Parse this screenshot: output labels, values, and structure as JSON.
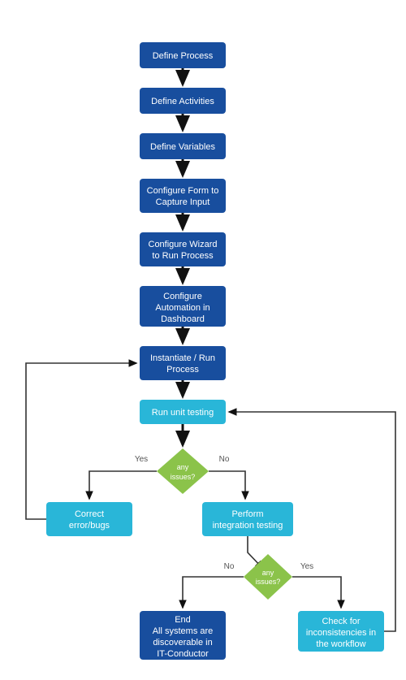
{
  "colors": {
    "dark_blue": "#184e9e",
    "light_blue": "#29b6d8",
    "green": "#8bc34a",
    "arrow": "#111111",
    "line": "#333333"
  },
  "nodes": {
    "n1": {
      "line1": "Define Process"
    },
    "n2": {
      "line1": "Define Activities"
    },
    "n3": {
      "line1": "Define Variables"
    },
    "n4": {
      "line1": "Configure Form to",
      "line2": "Capture Input"
    },
    "n5": {
      "line1": "Configure Wizard",
      "line2": "to Run Process"
    },
    "n6": {
      "line1": "Configure",
      "line2": "Automation in",
      "line3": "Dashboard"
    },
    "n7": {
      "line1": "Instantiate / Run",
      "line2": "Process"
    },
    "n8": {
      "line1": "Run unit testing"
    },
    "d1": {
      "line1": "any",
      "line2": "issues?"
    },
    "n9": {
      "line1": "Correct",
      "line2": "error/bugs"
    },
    "n10": {
      "line1": "Perform",
      "line2": "integration testing"
    },
    "d2": {
      "line1": "any",
      "line2": "issues?"
    },
    "n11": {
      "line1": "End",
      "line2": "All systems are",
      "line3": "discoverable in",
      "line4": "IT-Conductor"
    },
    "n12": {
      "line1": "Check for",
      "line2": "inconsistencies in",
      "line3": "the workflow"
    }
  },
  "labels": {
    "d1_yes": "Yes",
    "d1_no": "No",
    "d2_yes": "Yes",
    "d2_no": "No"
  }
}
